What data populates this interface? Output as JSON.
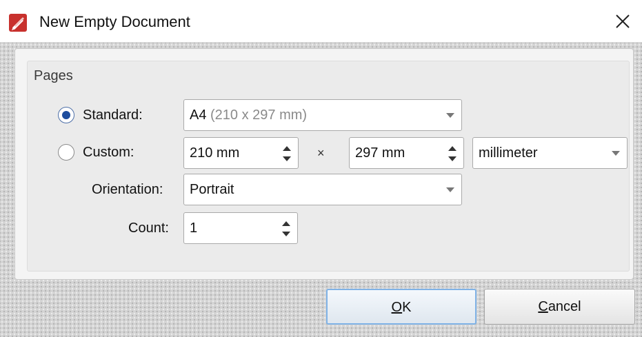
{
  "window": {
    "title": "New Empty Document",
    "icon": "pdf-editor-app-icon",
    "close_icon": "close-icon"
  },
  "pages_group": {
    "title": "Pages",
    "standard": {
      "label": "Standard:",
      "selected": true,
      "value_main": "A4",
      "value_detail": " (210 x 297 mm)"
    },
    "custom": {
      "label": "Custom:",
      "selected": false,
      "width_value": "210 mm",
      "separator": "×",
      "height_value": "297 mm",
      "unit_value": "millimeter"
    },
    "orientation": {
      "label": "Orientation:",
      "value": "Portrait"
    },
    "count": {
      "label": "Count:",
      "value": "1"
    }
  },
  "buttons": {
    "ok": {
      "mnemonic": "O",
      "rest": "K"
    },
    "cancel": {
      "mnemonic": "C",
      "rest": "ancel"
    }
  },
  "colors": {
    "accent": "#1e4d9e",
    "ok_border": "#7fb2e6",
    "icon_red": "#c8312d"
  }
}
